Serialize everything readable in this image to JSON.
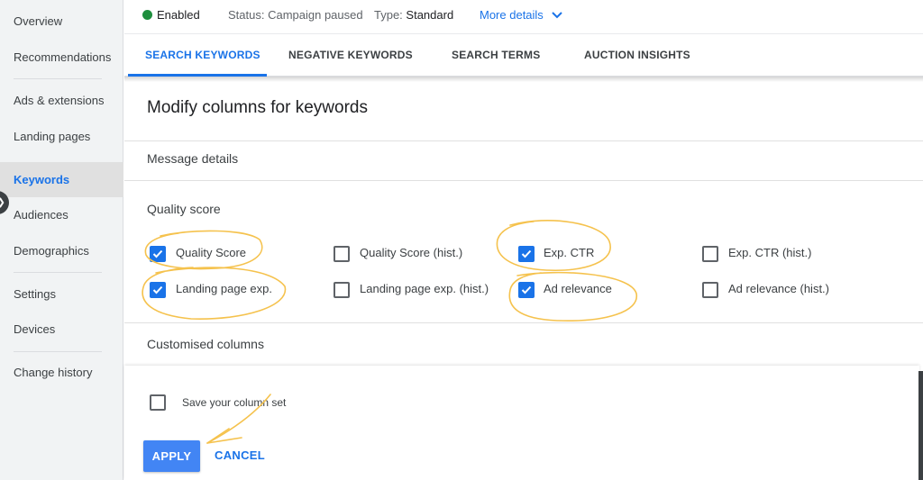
{
  "sidebar": {
    "items": [
      {
        "label": "Overview"
      },
      {
        "label": "Recommendations"
      },
      {
        "label": "Ads & extensions"
      },
      {
        "label": "Landing pages"
      },
      {
        "label": "Keywords",
        "active": true
      },
      {
        "label": "Audiences"
      },
      {
        "label": "Demographics"
      },
      {
        "label": "Settings"
      },
      {
        "label": "Devices"
      },
      {
        "label": "Change history"
      }
    ]
  },
  "status_bar": {
    "state": "Enabled",
    "status": "Status: Campaign paused",
    "type_label": "Type:",
    "type_value": "Standard",
    "more_details": "More details"
  },
  "tabs": [
    {
      "label": "SEARCH KEYWORDS",
      "active": true
    },
    {
      "label": "NEGATIVE KEYWORDS"
    },
    {
      "label": "SEARCH TERMS"
    },
    {
      "label": "AUCTION INSIGHTS"
    }
  ],
  "panel": {
    "title": "Modify columns for keywords",
    "message_details": "Message details",
    "quality_score_heading": "Quality score",
    "options": [
      {
        "label": "Quality Score",
        "checked": true
      },
      {
        "label": "Quality Score (hist.)",
        "checked": false
      },
      {
        "label": "Exp. CTR",
        "checked": true
      },
      {
        "label": "Exp. CTR (hist.)",
        "checked": false
      },
      {
        "label": "Landing page exp.",
        "checked": true
      },
      {
        "label": "Landing page exp. (hist.)",
        "checked": false
      },
      {
        "label": "Ad relevance",
        "checked": true
      },
      {
        "label": "Ad relevance (hist.)",
        "checked": false
      }
    ],
    "customised_columns": "Customised columns"
  },
  "footer": {
    "save_column_set": "Save your column set",
    "save_checked": false,
    "apply": "APPLY",
    "cancel": "CANCEL"
  },
  "colors": {
    "accent": "#1a73e8",
    "apply_button": "#4285f4",
    "enabled_dot": "#1e8e3e",
    "annotation": "#f5c24d"
  }
}
